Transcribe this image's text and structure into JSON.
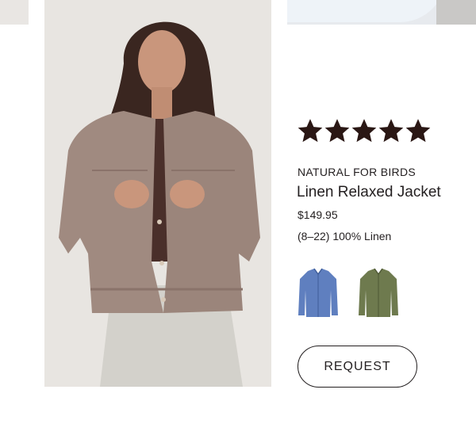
{
  "product": {
    "brand": "NATURAL FOR BIRDS",
    "name": "Linen Relaxed Jacket",
    "price": "$149.95",
    "details": "(8–22) 100% Linen",
    "rating": 5,
    "max_rating": 5,
    "image_icon": "model-photo",
    "colors": [
      {
        "name": "blue-denim",
        "hex": "#5f7fbf"
      },
      {
        "name": "olive",
        "hex": "#6e7a4e"
      }
    ],
    "request_label": "REQUEST"
  },
  "colors": {
    "star": "#2a1714",
    "text": "#231f20",
    "jacket": "#a08a80"
  }
}
